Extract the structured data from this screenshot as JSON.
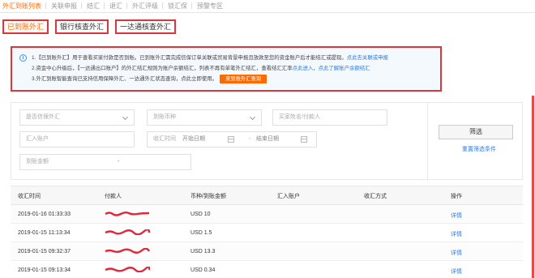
{
  "top_tabs": [
    "外汇到账列表",
    "关联申报",
    "结汇",
    "退汇",
    "外汇评级",
    "锁汇保",
    "预警专区"
  ],
  "sub_tabs": [
    "已到账外汇",
    "银行核查外汇",
    "一达通核查外汇"
  ],
  "notice": {
    "line1": "1.【已到账外汇】用于查看买家付款是否到账。已到账外汇需完成信保订单关联或贸易背景申报且放款至您的资金账户后才能结汇或提现。",
    "line1_link": "点此去关联或申报",
    "line2": "2.资金中心升级后，【一达通出口账户】的外汇结汇规则为账户余额结汇，列表不再有单笔外汇结汇，查看结汇汇率",
    "line2_link1": "点此进入",
    "line2_mid": "，",
    "line2_link2": "点此了解账户余额结汇",
    "line3": "3.外汇到账智能查询已支持信用保障外汇、一达通外汇状态查询，点此立即使用。",
    "line3_button": "来到账外汇查询"
  },
  "filters": {
    "credit_insured": "是否信保外汇",
    "currency": "到账币种",
    "buyer_name": "买家姓名/付款人",
    "remit_account": "汇入账户",
    "receive_time_label": "收汇时间",
    "start_date": "开始日期",
    "separator": "-",
    "end_date": "结束日期",
    "amount_label": "到账金额",
    "amount_sep": "-",
    "filter_button": "筛选",
    "reset_link": "重置筛选条件"
  },
  "table": {
    "headers": [
      "收汇时间",
      "付款人",
      "币种/到账金额",
      "汇入账户",
      "收汇方式",
      "操作"
    ],
    "rows": [
      {
        "time": "2019-01-16 01:33:33",
        "amount": "USD 10",
        "action": "详情"
      },
      {
        "time": "2019-01-15 11:13:34",
        "amount": "USD 1.5",
        "action": "详情"
      },
      {
        "time": "2019-01-15 09:32:37",
        "amount": "USD 13.3",
        "action": "详情"
      },
      {
        "time": "2019-01-15 09:13:34",
        "amount": "USD 0.34",
        "action": "详情"
      }
    ]
  },
  "colors": {
    "accent": "#ff6a00",
    "link": "#2d7be0",
    "highlight": "#d9363e",
    "redaction": "#e0283a"
  }
}
